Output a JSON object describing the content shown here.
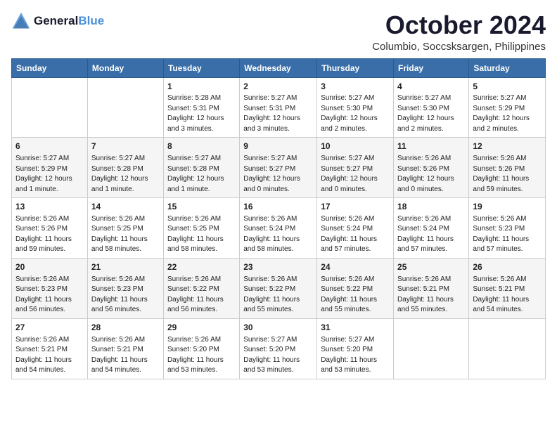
{
  "logo": {
    "line1": "General",
    "line2": "Blue"
  },
  "title": "October 2024",
  "location": "Columbio, Soccsksargen, Philippines",
  "headers": [
    "Sunday",
    "Monday",
    "Tuesday",
    "Wednesday",
    "Thursday",
    "Friday",
    "Saturday"
  ],
  "weeks": [
    [
      {
        "day": "",
        "info": ""
      },
      {
        "day": "",
        "info": ""
      },
      {
        "day": "1",
        "info": "Sunrise: 5:28 AM\nSunset: 5:31 PM\nDaylight: 12 hours\nand 3 minutes."
      },
      {
        "day": "2",
        "info": "Sunrise: 5:27 AM\nSunset: 5:31 PM\nDaylight: 12 hours\nand 3 minutes."
      },
      {
        "day": "3",
        "info": "Sunrise: 5:27 AM\nSunset: 5:30 PM\nDaylight: 12 hours\nand 2 minutes."
      },
      {
        "day": "4",
        "info": "Sunrise: 5:27 AM\nSunset: 5:30 PM\nDaylight: 12 hours\nand 2 minutes."
      },
      {
        "day": "5",
        "info": "Sunrise: 5:27 AM\nSunset: 5:29 PM\nDaylight: 12 hours\nand 2 minutes."
      }
    ],
    [
      {
        "day": "6",
        "info": "Sunrise: 5:27 AM\nSunset: 5:29 PM\nDaylight: 12 hours\nand 1 minute."
      },
      {
        "day": "7",
        "info": "Sunrise: 5:27 AM\nSunset: 5:28 PM\nDaylight: 12 hours\nand 1 minute."
      },
      {
        "day": "8",
        "info": "Sunrise: 5:27 AM\nSunset: 5:28 PM\nDaylight: 12 hours\nand 1 minute."
      },
      {
        "day": "9",
        "info": "Sunrise: 5:27 AM\nSunset: 5:27 PM\nDaylight: 12 hours\nand 0 minutes."
      },
      {
        "day": "10",
        "info": "Sunrise: 5:27 AM\nSunset: 5:27 PM\nDaylight: 12 hours\nand 0 minutes."
      },
      {
        "day": "11",
        "info": "Sunrise: 5:26 AM\nSunset: 5:26 PM\nDaylight: 12 hours\nand 0 minutes."
      },
      {
        "day": "12",
        "info": "Sunrise: 5:26 AM\nSunset: 5:26 PM\nDaylight: 11 hours\nand 59 minutes."
      }
    ],
    [
      {
        "day": "13",
        "info": "Sunrise: 5:26 AM\nSunset: 5:26 PM\nDaylight: 11 hours\nand 59 minutes."
      },
      {
        "day": "14",
        "info": "Sunrise: 5:26 AM\nSunset: 5:25 PM\nDaylight: 11 hours\nand 58 minutes."
      },
      {
        "day": "15",
        "info": "Sunrise: 5:26 AM\nSunset: 5:25 PM\nDaylight: 11 hours\nand 58 minutes."
      },
      {
        "day": "16",
        "info": "Sunrise: 5:26 AM\nSunset: 5:24 PM\nDaylight: 11 hours\nand 58 minutes."
      },
      {
        "day": "17",
        "info": "Sunrise: 5:26 AM\nSunset: 5:24 PM\nDaylight: 11 hours\nand 57 minutes."
      },
      {
        "day": "18",
        "info": "Sunrise: 5:26 AM\nSunset: 5:24 PM\nDaylight: 11 hours\nand 57 minutes."
      },
      {
        "day": "19",
        "info": "Sunrise: 5:26 AM\nSunset: 5:23 PM\nDaylight: 11 hours\nand 57 minutes."
      }
    ],
    [
      {
        "day": "20",
        "info": "Sunrise: 5:26 AM\nSunset: 5:23 PM\nDaylight: 11 hours\nand 56 minutes."
      },
      {
        "day": "21",
        "info": "Sunrise: 5:26 AM\nSunset: 5:23 PM\nDaylight: 11 hours\nand 56 minutes."
      },
      {
        "day": "22",
        "info": "Sunrise: 5:26 AM\nSunset: 5:22 PM\nDaylight: 11 hours\nand 56 minutes."
      },
      {
        "day": "23",
        "info": "Sunrise: 5:26 AM\nSunset: 5:22 PM\nDaylight: 11 hours\nand 55 minutes."
      },
      {
        "day": "24",
        "info": "Sunrise: 5:26 AM\nSunset: 5:22 PM\nDaylight: 11 hours\nand 55 minutes."
      },
      {
        "day": "25",
        "info": "Sunrise: 5:26 AM\nSunset: 5:21 PM\nDaylight: 11 hours\nand 55 minutes."
      },
      {
        "day": "26",
        "info": "Sunrise: 5:26 AM\nSunset: 5:21 PM\nDaylight: 11 hours\nand 54 minutes."
      }
    ],
    [
      {
        "day": "27",
        "info": "Sunrise: 5:26 AM\nSunset: 5:21 PM\nDaylight: 11 hours\nand 54 minutes."
      },
      {
        "day": "28",
        "info": "Sunrise: 5:26 AM\nSunset: 5:21 PM\nDaylight: 11 hours\nand 54 minutes."
      },
      {
        "day": "29",
        "info": "Sunrise: 5:26 AM\nSunset: 5:20 PM\nDaylight: 11 hours\nand 53 minutes."
      },
      {
        "day": "30",
        "info": "Sunrise: 5:27 AM\nSunset: 5:20 PM\nDaylight: 11 hours\nand 53 minutes."
      },
      {
        "day": "31",
        "info": "Sunrise: 5:27 AM\nSunset: 5:20 PM\nDaylight: 11 hours\nand 53 minutes."
      },
      {
        "day": "",
        "info": ""
      },
      {
        "day": "",
        "info": ""
      }
    ]
  ]
}
